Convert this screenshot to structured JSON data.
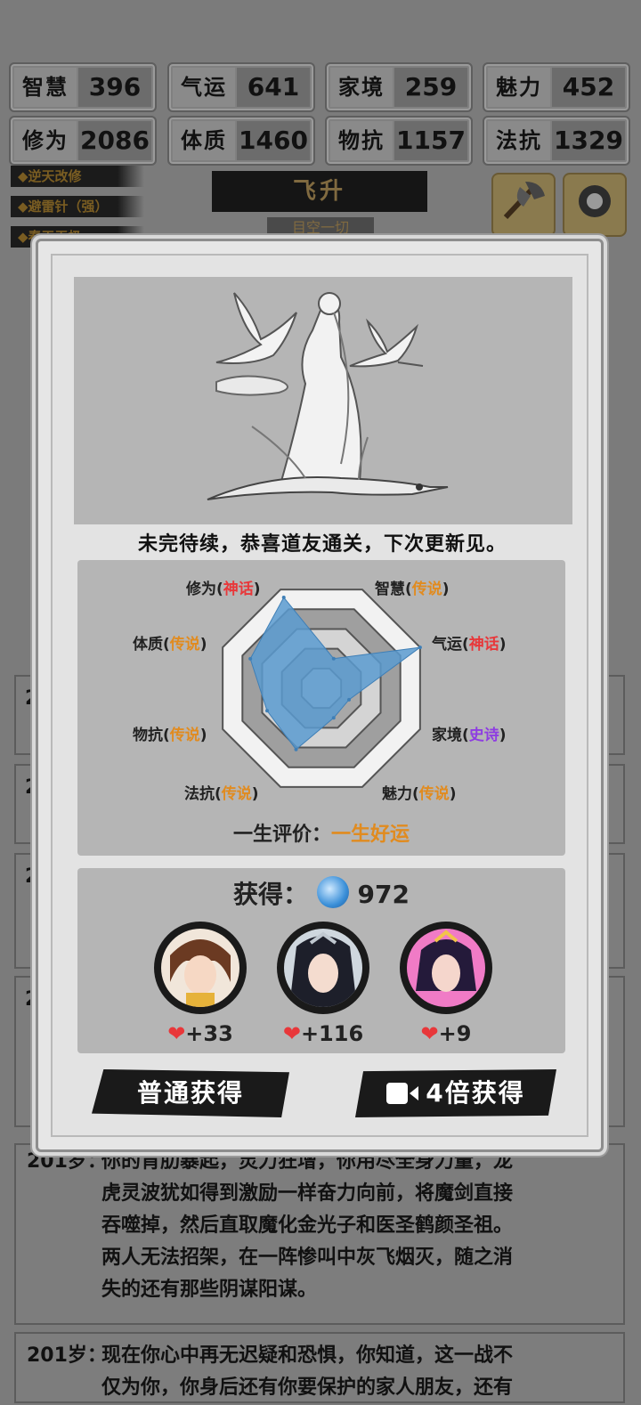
{
  "stats": [
    {
      "label": "智慧",
      "value": "396"
    },
    {
      "label": "气运",
      "value": "641"
    },
    {
      "label": "家境",
      "value": "259"
    },
    {
      "label": "魅力",
      "value": "452"
    },
    {
      "label": "修为",
      "value": "2086"
    },
    {
      "label": "体质",
      "value": "1460"
    },
    {
      "label": "物抗",
      "value": "1157"
    },
    {
      "label": "法抗",
      "value": "1329"
    }
  ],
  "talents": [
    "◆逆天改修",
    "◆避雷针（强）",
    "◆春天无极"
  ],
  "ascend": {
    "title": "飞升",
    "subtitle": "目空一切"
  },
  "log_ages": [
    "201",
    "201",
    "201",
    "201"
  ],
  "log": {
    "age": "201岁：",
    "text_1": "你的肯肋暴起，灵力狂增，你用尽全身力量，龙",
    "text_2": "虎灵波犹如得到激励一样奋力向前，将魔剑直接",
    "text_3": "吞噬掉，然后直取魔化金光子和医圣鹤颜圣祖。",
    "text_4": "两人无法招架，在一阵惨叫中灰飞烟灭，随之消",
    "text_5": "失的还有那些阴谋阳谋。",
    "age2": "201岁：",
    "text_6": "现在你心中再无迟疑和恐惧，你知道，这一战不",
    "text_7": "仅为你，你身后还有你要保护的家人朋友，还有"
  },
  "modal": {
    "message": "未完待续，恭喜道友通关，下次更新见。",
    "radar": [
      {
        "attr": "修为",
        "level": "神话",
        "tier": "myth",
        "score": 0.92
      },
      {
        "attr": "智慧",
        "level": "传说",
        "tier": "leg",
        "score": 0.3
      },
      {
        "attr": "气运",
        "level": "神话",
        "tier": "myth",
        "score": 1.0
      },
      {
        "attr": "家境",
        "level": "史诗",
        "tier": "epic",
        "score": 0.28
      },
      {
        "attr": "魅力",
        "level": "传说",
        "tier": "leg",
        "score": 0.3
      },
      {
        "attr": "法抗",
        "level": "传说",
        "tier": "leg",
        "score": 0.62
      },
      {
        "attr": "物抗",
        "level": "传说",
        "tier": "leg",
        "score": 0.55
      },
      {
        "attr": "体质",
        "level": "传说",
        "tier": "leg",
        "score": 0.72
      }
    ],
    "evaluation_label": "一生评价：",
    "evaluation_value": "一生好运",
    "gain_label": "获得：",
    "gain_amount": "972",
    "companions": [
      {
        "affection": "+33"
      },
      {
        "affection": "+116"
      },
      {
        "affection": "+9"
      }
    ],
    "normal_button": "普通获得",
    "video_button": "4倍获得"
  },
  "colors": {
    "myth": "#e8373a",
    "legend": "#e18b1f",
    "epic": "#8e3ce2",
    "radar_fill": "#5b9bd0"
  }
}
